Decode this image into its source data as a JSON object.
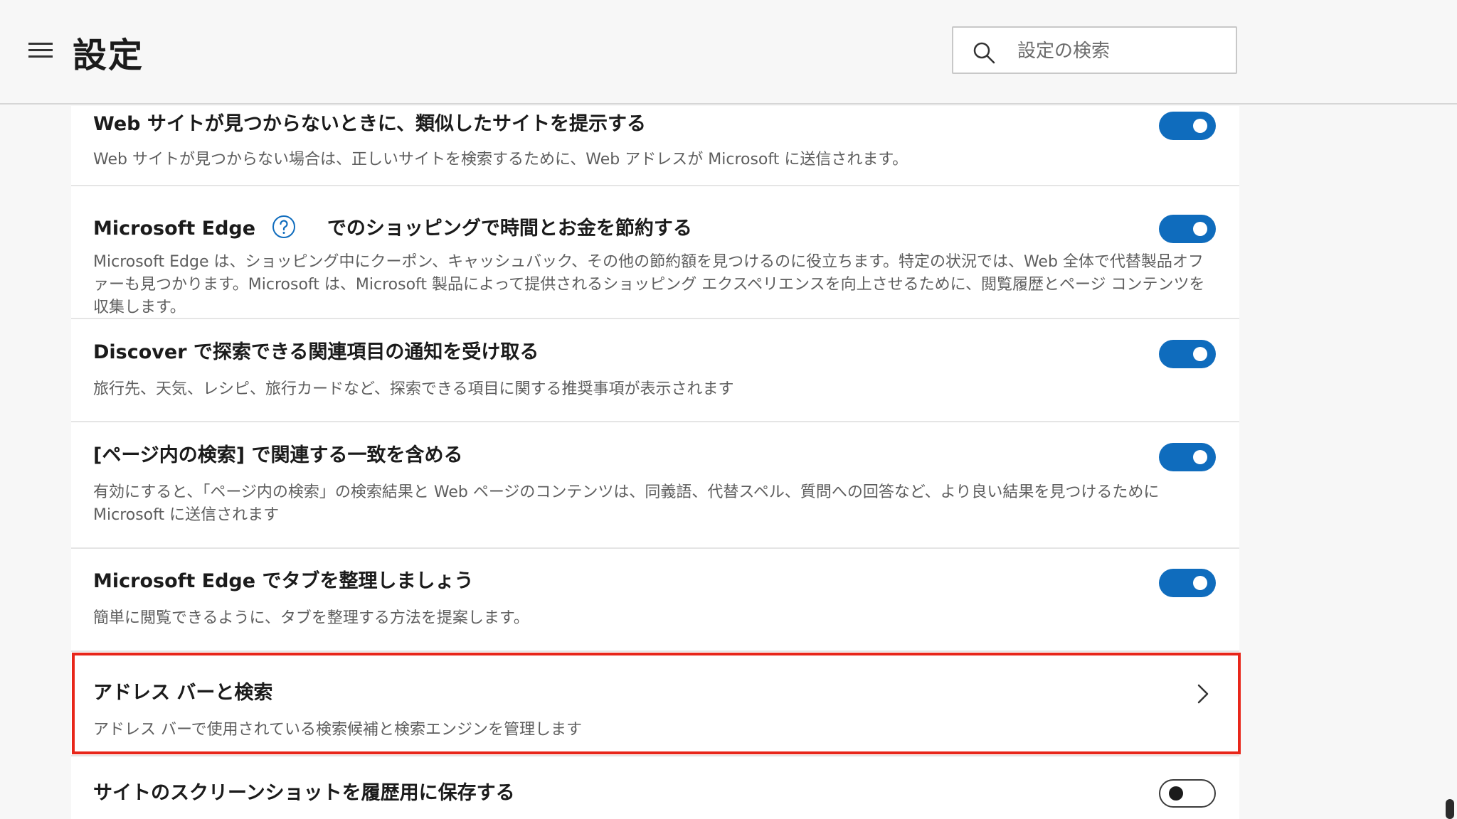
{
  "header": {
    "title": "設定",
    "search_placeholder": "設定の検索"
  },
  "settings": [
    {
      "title": "Web サイトが見つからないときに、類似したサイトを提示する",
      "description": "Web サイトが見つからない場合は、正しいサイトを検索するために、Web アドレスが Microsoft に送信されます。",
      "toggle": "on"
    },
    {
      "title_prefix": "Microsoft Edge",
      "title_suffix": "でのショッピングで時間とお金を節約する",
      "description": "Microsoft Edge は、ショッピング中にクーポン、キャッシュバック、その他の節約額を見つけるのに役立ちます。特定の状況では、Web 全体で代替製品オファーも見つかります。Microsoft は、Microsoft 製品によって提供されるショッピング エクスペリエンスを向上させるために、閲覧履歴とページ コンテンツを収集します。",
      "toggle": "on"
    },
    {
      "title": "Discover で探索できる関連項目の通知を受け取る",
      "description": "旅行先、天気、レシピ、旅行カードなど、探索できる項目に関する推奨事項が表示されます",
      "toggle": "on"
    },
    {
      "title": "[ページ内の検索] で関連する一致を含める",
      "description": "有効にすると、「ページ内の検索」の検索結果と Web ページのコンテンツは、同義語、代替スペル、質問への回答など、より良い結果を見つけるために Microsoft に送信されます",
      "toggle": "on"
    },
    {
      "title": "Microsoft Edge でタブを整理しましょう",
      "description": "簡単に閲覧できるように、タブを整理する方法を提案します。",
      "toggle": "on"
    },
    {
      "title": "アドレス バーと検索",
      "description": "アドレス バーで使用されている検索候補と検索エンジンを管理します",
      "control": "chevron-right"
    },
    {
      "title": "サイトのスクリーンショットを履歴用に保存する",
      "toggle": "off"
    }
  ],
  "colors": {
    "accent": "#0f6cbd",
    "highlight": "#e8261a"
  }
}
